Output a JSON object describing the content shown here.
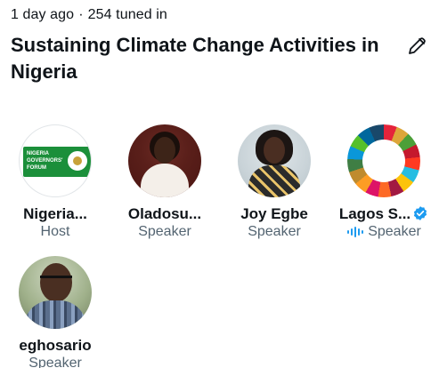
{
  "space": {
    "meta_time": "1 day ago",
    "meta_separator": "·",
    "meta_tuned": "254 tuned in",
    "title": "Sustaining Climate Change Activities in Nigeria",
    "edit_icon": "pencil-icon"
  },
  "logo_text": "NIGERIA GOVERNORS' FORUM",
  "participants": [
    {
      "name": "Nigeria...",
      "role": "Host",
      "avatar": "ngf-logo"
    },
    {
      "name": "Oladosu...",
      "role": "Speaker",
      "avatar": "woman-photo"
    },
    {
      "name": "Joy Egbe",
      "role": "Speaker",
      "avatar": "woman-photo"
    },
    {
      "name": "Lagos S...",
      "role": "Speaker",
      "avatar": "sdg-wheel",
      "verified": true,
      "speaking": true
    },
    {
      "name": "eghosario",
      "role": "Speaker",
      "avatar": "man-photo"
    }
  ],
  "colors": {
    "text": "#0f1419",
    "secondary": "#536471",
    "accent": "#1d9bf0"
  }
}
